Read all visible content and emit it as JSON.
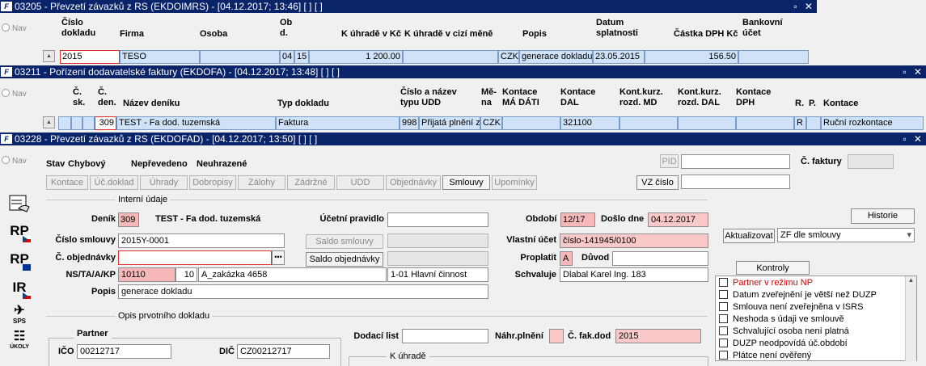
{
  "win1": {
    "title": "03205 - Převzetí závazků z RS (EKDOIMRS) - [04.12.2017; 13:46]  [ ]  [ ]",
    "nav": "Nav",
    "headers": {
      "cislo_dokladu": "Číslo\ndokladu",
      "firma": "Firma",
      "osoba": "Osoba",
      "obd": "Ob\nd.",
      "k_uhrade_kc": "K úhradě v Kč",
      "k_uhrade_mena": "K úhradě v cizí měně",
      "popis": "Popis",
      "datum_splatnosti": "Datum\nsplatnosti",
      "castka_dph": "Částka DPH Kč",
      "bankovni_ucet": "Bankovní\núčet"
    },
    "row": {
      "cislo": "2015",
      "firma": "TESO",
      "osoba": "",
      "obd1": "04",
      "obd2": "15",
      "k_uhrade_kc": "1 200.00",
      "k_uhrade_mena": "",
      "mena": "CZK",
      "popis": "generace dokladu",
      "datum": "23.05.2015",
      "castka_dph": "156.50",
      "ucet": ""
    }
  },
  "win2": {
    "title": "03211 - Pořízení dodavatelské faktury (EKDOFA) - [04.12.2017; 13:48]  [ ]  [ ]",
    "nav": "Nav",
    "headers": {
      "c_sk": "Č.\nsk.",
      "c_den": "Č.\nden.",
      "nazev_deniku": "Název deníku",
      "typ_dokladu": "Typ dokladu",
      "cislo_nazev_typu": "Číslo a název\ntypu UDD",
      "mena": "Mě-\nna",
      "kontace_ma_dati": "Kontace\nMÁ DÁTI",
      "kontace_dal": "Kontace\nDAL",
      "kont_kurz_md": "Kont.kurz.\nrozd. MD",
      "kont_kurz_dal": "Kont.kurz.\nrozd. DAL",
      "kontace_dph": "Kontace\nDPH",
      "r": "R.",
      "p": "P.",
      "kontace": "Kontace"
    },
    "row": {
      "c_den": "309",
      "nazev": "TEST - Fa dod. tuzemská",
      "typ": "Faktura",
      "cislo_typu": "998",
      "nazev_typu": "Přijatá plnění z",
      "mena": "CZK",
      "ma_dati": "",
      "dal": "321100",
      "r": "R",
      "kontace": "Ruční rozkontace"
    }
  },
  "win3": {
    "title": "03228 - Převzetí závazků z RS (EKDOFAD) - [04.12.2017; 13:50]  [ ]  [ ]",
    "nav": "Nav",
    "stav_label": "Stav",
    "stav_value": "Chybový",
    "neprevedeno": "Nepřevedeno",
    "neuhrazene": "Neuhrazené",
    "pid_label": "PID",
    "pid_value": "",
    "c_faktury_label": "Č. faktury",
    "c_faktury_value": "",
    "vz_cislo_label": "VZ číslo",
    "vz_cislo_value": "",
    "tabs": [
      "Kontace",
      "Úč.doklad",
      "Úhrady",
      "Dobropisy",
      "Zálohy",
      "Zádržné",
      "UDD",
      "Objednávky",
      "Smlouvy",
      "Upomínky"
    ],
    "sections": {
      "interni": "Interní údaje",
      "opis": "Opis prvotního dokladu",
      "partner": "Partner",
      "k_uhrade": "K úhradě"
    },
    "denik_label": "Deník",
    "denik_value": "309",
    "denik_nazev": "TEST - Fa dod. tuzemská",
    "ucetni_pravidlo_label": "Účetní pravidlo",
    "ucetni_pravidlo_value": "",
    "obdobi_label": "Období",
    "obdobi_value": "12/17",
    "doslo_dne_label": "Došlo dne",
    "doslo_dne_value": "04.12.2017",
    "historie_button": "Historie",
    "cislo_smlouvy_label": "Číslo smlouvy",
    "cislo_smlouvy_value": "2015Y-0001",
    "saldo_smlouvy_button": "Saldo smlouvy",
    "saldo_smlouvy_value": "",
    "vlastni_ucet_label": "Vlastní účet",
    "vlastni_ucet_value": "číslo-141945/0100",
    "aktualizovat_button": "Aktualizovat",
    "zf_select": "ZF dle smlouvy",
    "c_objednavky_label": "Č. objednávky",
    "c_objednavky_value": "",
    "saldo_objednavky_button": "Saldo objednávky",
    "saldo_objednavky_value": "",
    "proplatit_label": "Proplatit",
    "proplatit_value": "A",
    "duvod_label": "Důvod",
    "duvod_value": "",
    "nstaakp_label": "NS/TA/A/KP",
    "ns_value": "10110",
    "ta_value": "10",
    "zakazka_value": "A_zakázka 4658",
    "cinnost_value": "1-01 Hlavní činnost",
    "schvaluje_label": "Schvaluje",
    "schvaluje_value": "Dlabal Karel Ing. 183",
    "popis_label": "Popis",
    "popis_value": "generace dokladu",
    "kontroly_button": "Kontroly",
    "kontroly_items": [
      "Partner v režimu NP",
      "Datum zveřejnění je větší než DUZP",
      "Smlouva není zveřejněna v ISRS",
      "Neshoda s údaji ve smlouvě",
      "Schvalující osoba není platná",
      "DUZP neodpovídá úč.období",
      "Plátce není ověřený"
    ],
    "kontroly_alert_color": "#d00000",
    "dodaci_list_label": "Dodací list",
    "dodaci_list_value": "",
    "nahr_plneni_label": "Náhr.plnění",
    "nahr_plneni_value": "",
    "c_fak_dod_label": "Č. fak.dod",
    "c_fak_dod_value": "2015",
    "ico_label": "IČO",
    "ico_value": "00212717",
    "dic_label": "DIČ",
    "dic_value": "CZ00212717",
    "tools": [
      "RP",
      "RP",
      "IR",
      "SPS",
      "ÚKOLY"
    ]
  }
}
